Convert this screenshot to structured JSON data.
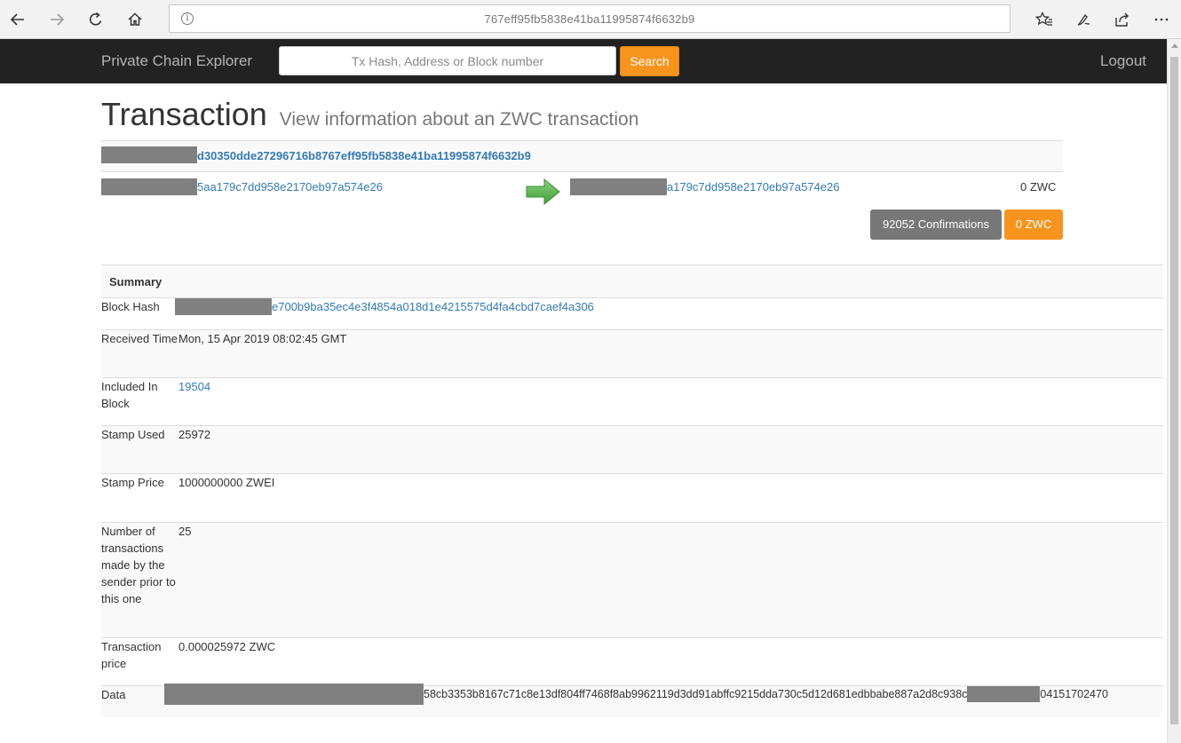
{
  "browser": {
    "url": "767eff95fb5838e41ba11995874f6632b9",
    "icons": [
      "back-icon",
      "forward-icon",
      "refresh-icon",
      "home-icon",
      "info-icon",
      "favorites-icon",
      "notes-icon",
      "share-icon",
      "more-icon"
    ]
  },
  "navbar": {
    "brand": "Private Chain Explorer",
    "search_placeholder": "Tx Hash, Address or Block number",
    "search_label": "Search",
    "logout_label": "Logout"
  },
  "header": {
    "title": "Transaction",
    "subtitle": "View information about an ZWC transaction"
  },
  "transaction": {
    "hash_visible": "d30350dde27296716b8767eff95fb5838e41ba11995874f6632b9",
    "from_visible": "5aa179c7dd958e2170eb97a574e26",
    "to_visible": "a179c7dd958e2170eb97a574e26",
    "value": "0 ZWC",
    "confirmations": "92052 Confirmations",
    "value_badge": "0 ZWC"
  },
  "summary": {
    "heading": "Summary",
    "rows": [
      {
        "label": "Block Hash",
        "value": "e700b9ba35ec4e3f4854a018d1e4215575d4fa4cbd7caef4a306"
      },
      {
        "label": "Received Time",
        "value": "Mon, 15 Apr 2019 08:02:45 GMT"
      },
      {
        "label": "Included In Block",
        "value": "19504"
      },
      {
        "label": "Stamp Used",
        "value": "25972"
      },
      {
        "label": "Stamp Price",
        "value": "1000000000 ZWEI"
      },
      {
        "label": "Number of transactions made by the sender prior to this one",
        "value": "25"
      },
      {
        "label": "Transaction price",
        "value": "0.000025972 ZWC"
      },
      {
        "label": "Data",
        "value_part1": "58cb3353b8167c71c8e13df804ff7468f8ab9962119d3dd91abffc9215dda730c5d12d681edbbabe887a2d8c938c",
        "value_part2": "04151702470"
      }
    ]
  },
  "colors": {
    "navbar_bg": "#222222",
    "accent_orange": "#f7941d",
    "link_blue": "#337ab7",
    "badge_gray": "#777777",
    "arrow_green": "#5cb85c",
    "redaction_gray": "#808080"
  }
}
